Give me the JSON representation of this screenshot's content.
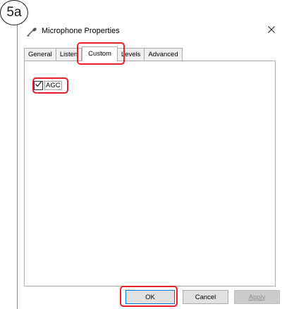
{
  "step_label": "5a",
  "window": {
    "title": "Microphone Properties",
    "close_symbol": "×"
  },
  "tabs": [
    {
      "label": "General",
      "active": false
    },
    {
      "label": "Listen",
      "active": false
    },
    {
      "label": "Custom",
      "active": true
    },
    {
      "label": "Levels",
      "active": false
    },
    {
      "label": "Advanced",
      "active": false
    }
  ],
  "panel": {
    "agc": {
      "label": "AGC",
      "checked": true
    }
  },
  "buttons": {
    "ok": "OK",
    "cancel": "Cancel",
    "apply": "Apply"
  },
  "colors": {
    "highlight": "#e8202a",
    "focus_border": "#0078d7"
  }
}
